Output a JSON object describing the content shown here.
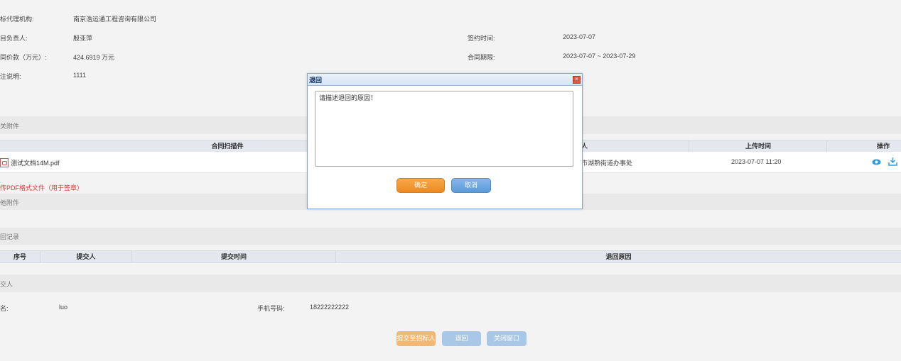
{
  "info": {
    "agency_label": "标代理机构:",
    "agency_value": "南京浩运通工程咨询有限公司",
    "manager_label": "目负责人:",
    "manager_value": "殷亚萍",
    "sign_label": "签约时间:",
    "sign_value": "2023-07-07",
    "amount_label": "同价款（万元）:",
    "amount_value": "424.6919 万元",
    "period_label": "合同期限:",
    "period_value": "2023-07-07 ~ 2023-07-29",
    "note_label": "注说明:",
    "note_value": "1111"
  },
  "attachments": {
    "section_title": "关附件",
    "col_scan": "合同扫描件",
    "col_uploader_fragment": "人",
    "col_upload_time": "上传时间",
    "col_action": "操作",
    "rows": [
      {
        "file": "测试文档14M.pdf",
        "uploader_fragment": "市湖熟街道办事处",
        "time": "2023-07-07 11:20"
      }
    ],
    "note": "传PDF格式文件（用于签章）"
  },
  "other_attachments": {
    "section_title": "他附件"
  },
  "return_records": {
    "section_title": "回记录",
    "col_no": "序号",
    "col_submitter": "提交人",
    "col_time": "提交时间",
    "col_reason": "退回原因"
  },
  "submitter": {
    "section_title": "交人",
    "name_label": "名:",
    "name_value": "luo",
    "phone_label": "手机号码:",
    "phone_value": "18222222222"
  },
  "actions": {
    "submit": "提交至招标人",
    "return": "退回",
    "close": "关闭窗口"
  },
  "dialog": {
    "title": "退回",
    "textarea_value": "请描述退回的原因！",
    "ok": "确定",
    "cancel": "取消"
  }
}
